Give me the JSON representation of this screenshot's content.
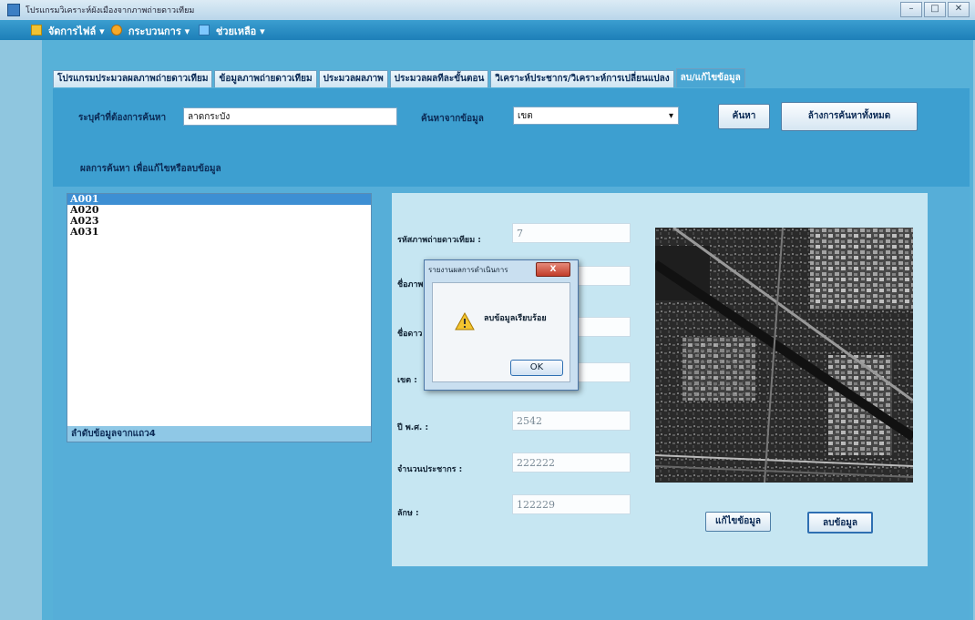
{
  "window": {
    "title": "โปรแกรมวิเคราะห์ผังเมืองจากภาพถ่ายดาวเทียม"
  },
  "menubar": {
    "items": [
      "จัดการไฟล์",
      "กระบวนการ",
      "ช่วยเหลือ"
    ]
  },
  "tabs": [
    {
      "label": "โปรแกรมประมวลผลภาพถ่ายดาวเทียม"
    },
    {
      "label": "ข้อมูลภาพถ่ายดาวเทียม"
    },
    {
      "label": "ประมวลผลภาพ"
    },
    {
      "label": "ประมวลผลทีละขั้นตอน"
    },
    {
      "label": "วิเคราะห์ประชากร/วิเคราะห์การเปลี่ยนแปลง"
    },
    {
      "label": "ลบ/แก้ไขข้อมูล"
    }
  ],
  "search": {
    "criteria_label": "ระบุคำที่ต้องการค้นหา",
    "criteria_value": "ลาดกระบัง",
    "type_label": "ค้นหาจากข้อมูล",
    "type_value": "เขต",
    "search_button": "ค้นหา",
    "clear_button": "ล้างการค้นหาทั้งหมด"
  },
  "results": {
    "heading": "ผลการค้นหา เพื่อแก้ไขหรือลบข้อมูล",
    "items": [
      "A001",
      "A020",
      "A023",
      "A031"
    ],
    "footer": "ลำดับข้อมูลจากแถว4"
  },
  "detail": {
    "fields": [
      {
        "label": "รหัสภาพถ่ายดาวเทียม :",
        "value": "7"
      },
      {
        "label": "ชื่อภาพ",
        "value": ""
      },
      {
        "label": "ชื่อดาว",
        "value": ""
      },
      {
        "label": "เขต :",
        "value": ""
      },
      {
        "label": "ปี พ.ศ. :",
        "value": "2542"
      },
      {
        "label": "จำนวนประชากร :",
        "value": "222222"
      },
      {
        "label": "ลักษ :",
        "value": "122229"
      }
    ],
    "edit_button": "แก้ไขข้อมูล",
    "delete_button": "ลบข้อมูล"
  },
  "dialog": {
    "title": "รายงานผลการดำเนินการ",
    "message": "ลบข้อมูลเรียบร้อย",
    "ok_label": "OK",
    "close_label": "X"
  },
  "colors": {
    "accent": "#3d9fd0",
    "menubar": "#1d7fb8",
    "selection": "#3d8fd3"
  },
  "icons": [
    "app-icon",
    "folder-icon",
    "gear-icon",
    "help-icon",
    "warning-icon",
    "close-icon",
    "dropdown-arrow-icon"
  ]
}
